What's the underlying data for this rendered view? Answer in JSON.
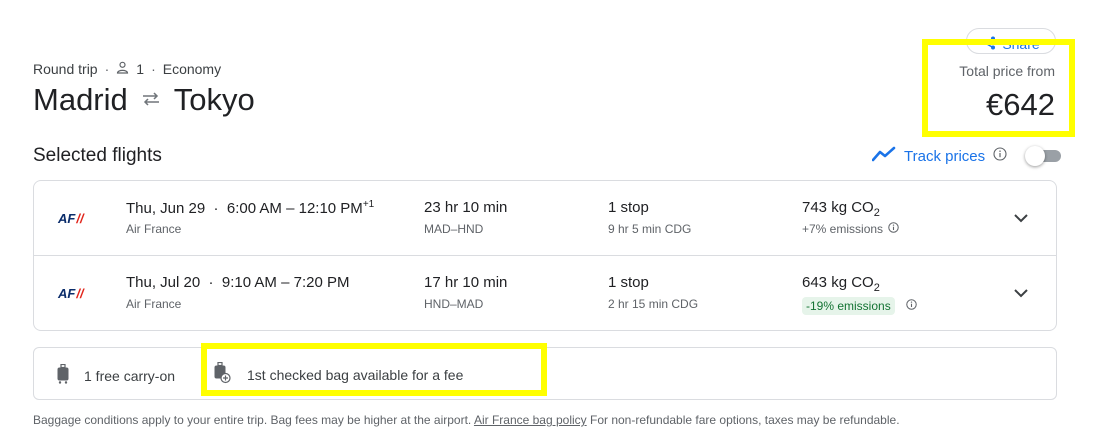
{
  "header": {
    "share_label": "Share",
    "trip_type": "Round trip",
    "passengers": "1",
    "cabin": "Economy",
    "origin": "Madrid",
    "destination": "Tokyo"
  },
  "price": {
    "label": "Total price from",
    "value": "€642"
  },
  "selected_title": "Selected flights",
  "track_prices": {
    "label": "Track prices",
    "enabled": false
  },
  "flights": [
    {
      "date": "Thu, Jun 29",
      "time_range": "6:00 AM – 12:10 PM",
      "day_offset": "+1",
      "airline": "Air France",
      "duration": "23 hr 10 min",
      "airports": "MAD–HND",
      "stops": "1 stop",
      "layover": "9 hr 5 min CDG",
      "co2_amount": "743 kg CO",
      "co2_sub": "2",
      "emissions": "+7% emissions"
    },
    {
      "date": "Thu, Jul 20",
      "time_range": "9:10 AM – 7:20 PM",
      "day_offset": "",
      "airline": "Air France",
      "duration": "17 hr 10 min",
      "airports": "HND–MAD",
      "stops": "1 stop",
      "layover": "2 hr 15 min CDG",
      "co2_amount": "643 kg CO",
      "co2_sub": "2",
      "emissions": "-19% emissions"
    }
  ],
  "baggage": {
    "carry_on": "1 free carry-on",
    "checked": "1st checked bag available for a fee",
    "note_before": "Baggage conditions apply to your entire trip. Bag fees may be higher at the airport.",
    "policy_link": "Air France bag policy",
    "note_after": "For non-refundable fare options, taxes may be refundable."
  },
  "colors": {
    "accent": "#1a73e8",
    "highlight": "#ffff00",
    "green_bg": "#e6f4ea",
    "green_text": "#137333"
  },
  "icons": {
    "share": "share-icon",
    "passenger": "person-icon",
    "swap": "swap-arrows-icon",
    "track": "trend-line-icon",
    "info": "info-icon",
    "expand": "chevron-down-icon",
    "carry_on": "carry-on-bag-icon",
    "checked_bag": "checked-bag-fee-icon"
  }
}
